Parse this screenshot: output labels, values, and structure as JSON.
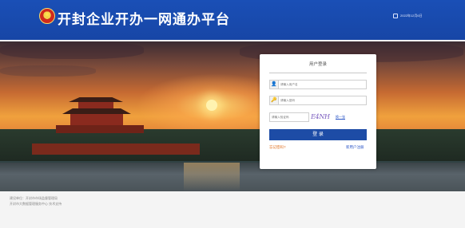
{
  "header": {
    "title": "开封企业开办一网通办平台",
    "date": "2022年12月6日",
    "icons": {
      "emblem": "national-emblem-icon",
      "calendar": "calendar-icon"
    },
    "colors": {
      "bar": "#1a4fb6"
    }
  },
  "login": {
    "title": "用户登录",
    "username_placeholder": "请输入用户名",
    "password_placeholder": "请输入密码",
    "captcha_placeholder": "请输入验证码",
    "captcha_image_text": "E4NH",
    "refresh_label": "换一张",
    "submit_label": "登 录",
    "forgot_label": "忘记密码?",
    "register_label": "新用户注册",
    "icons": {
      "user": "user-icon",
      "password": "key-icon"
    },
    "colors": {
      "button": "#1d4ca6",
      "forgot": "#e07020",
      "link": "#2a55c6"
    }
  },
  "footer": {
    "line1": "建设单位：开封市市场监督管理局",
    "line2": "开封市大数据管理服务中心 技术支持"
  }
}
